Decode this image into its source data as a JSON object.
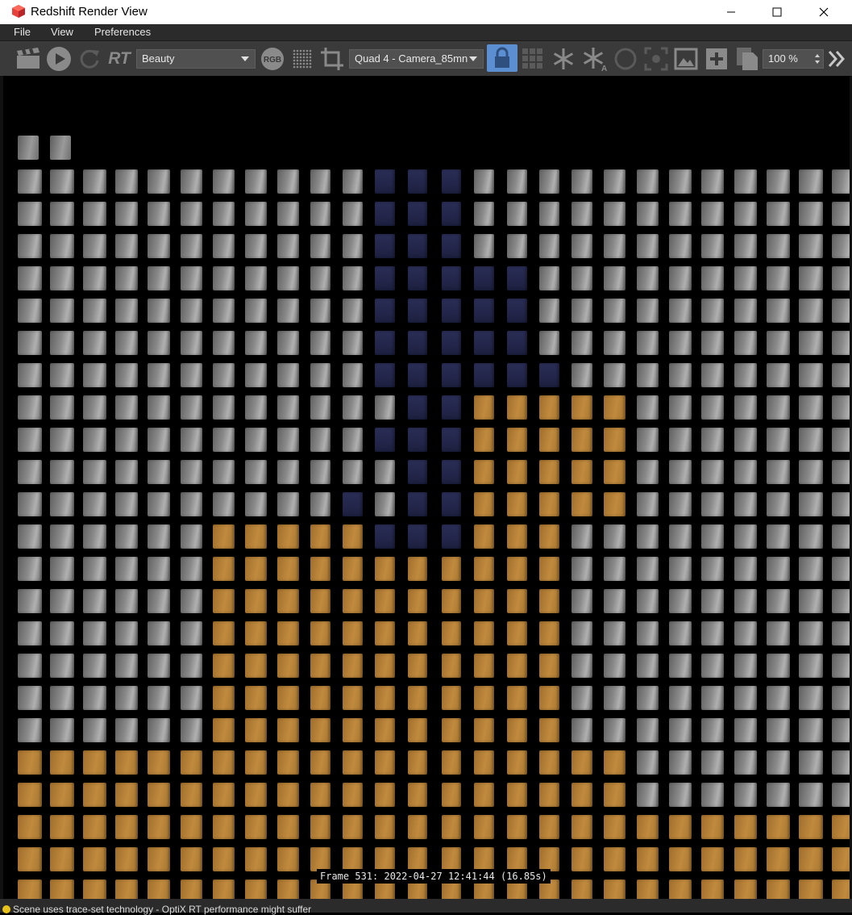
{
  "window": {
    "title": "Redshift Render View",
    "icon": "redshift-cube-icon",
    "controls": [
      "minimize-icon",
      "maximize-icon",
      "close-icon"
    ]
  },
  "menu": {
    "items": [
      "File",
      "View",
      "Preferences"
    ]
  },
  "toolbar": {
    "clapper": "clapperboard-icon",
    "play": "play-icon",
    "refresh": "refresh-icon",
    "rt_label": "RT",
    "aov_select": "Beauty",
    "rgb_label": "RGB",
    "camera_select": "Quad 4 - Camera_85mn",
    "zoom_value": "100 %",
    "accent_color": "#5b8fd1"
  },
  "render": {
    "frame_info": "Frame 531: 2022-04-27 12:41:44 (16.85s)",
    "tile_colors": {
      "gray": "#8a8a8a",
      "navy": "#23264a",
      "orange": "#c08a3e"
    }
  },
  "status": {
    "message": "Scene uses trace-set technology - OptiX RT performance might suffer",
    "indicator_color": "#e8c21a"
  }
}
